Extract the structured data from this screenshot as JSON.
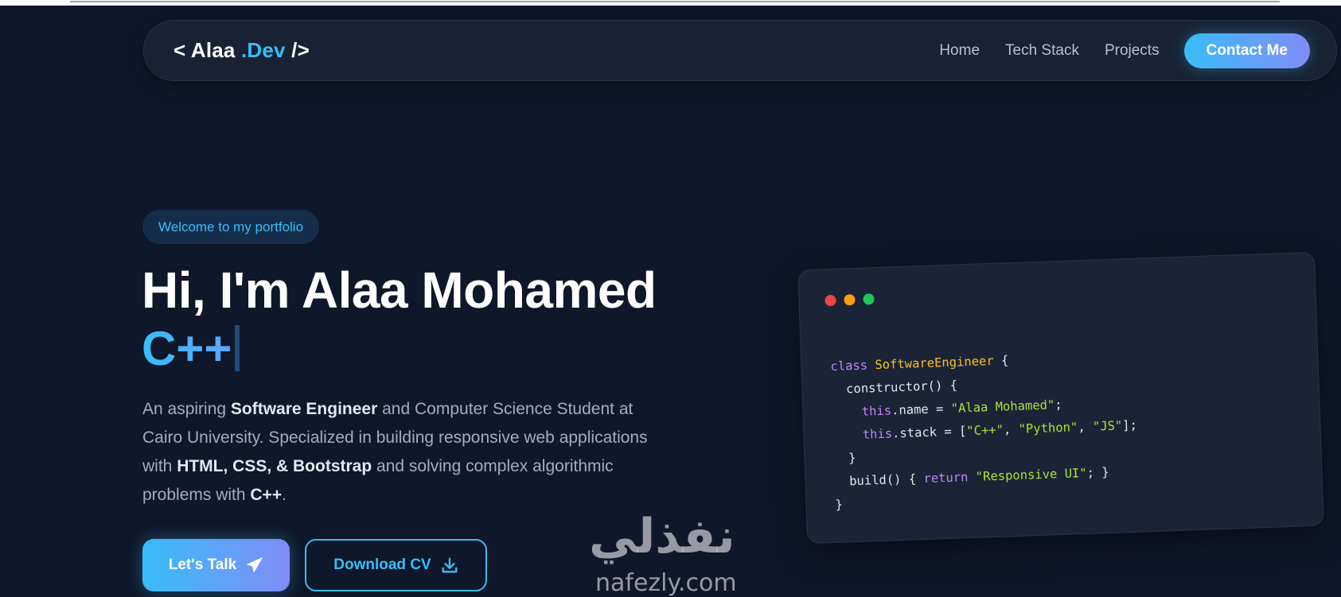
{
  "nav": {
    "logo_open": "< Alaa",
    "logo_accent": ".Dev",
    "logo_close": "/>",
    "links": [
      "Home",
      "Tech Stack",
      "Projects"
    ],
    "contact_label": "Contact Me"
  },
  "hero": {
    "badge": "Welcome to my portfolio",
    "title": "Hi, I'm Alaa Mohamed",
    "typed_text": "C++",
    "description": {
      "t1": "An aspiring ",
      "b1": "Software Engineer",
      "t2": " and Computer Science Student at Cairo University. Specialized in building responsive web applications with ",
      "b2": "HTML, CSS, & Bootstrap",
      "t3": " and solving complex algorithmic problems with ",
      "b3": "C++",
      "t4": "."
    },
    "talk_label": "Let's Talk",
    "cv_label": "Download CV"
  },
  "code_card": {
    "window_dots": [
      "#ef4444",
      "#f59e0b",
      "#22c55e"
    ],
    "line1": {
      "kw": "class",
      "name": "SoftwareEngineer",
      "rest": " {"
    },
    "line2": "constructor() {",
    "line3": {
      "kw": "this",
      "mid": ".name = ",
      "str": "\"Alaa Mohamed\"",
      "end": ";"
    },
    "line4": {
      "kw": "this",
      "mid": ".stack = [",
      "s1": "\"C++\"",
      "sep1": ", ",
      "s2": "\"Python\"",
      "sep2": ", ",
      "s3": "\"JS\"",
      "end": "];"
    },
    "line5": "}",
    "line6": {
      "pre": "build() { ",
      "kw": "return",
      "sp": " ",
      "str": "\"Responsive UI\"",
      "end": "; }"
    },
    "line7": "}"
  },
  "watermark": {
    "arabic": "نفذلي",
    "latin": "nafezly.com"
  },
  "colors": {
    "background": "#0f172a",
    "accent": "#38bdf8",
    "accent_gradient_end": "#818cf8"
  }
}
